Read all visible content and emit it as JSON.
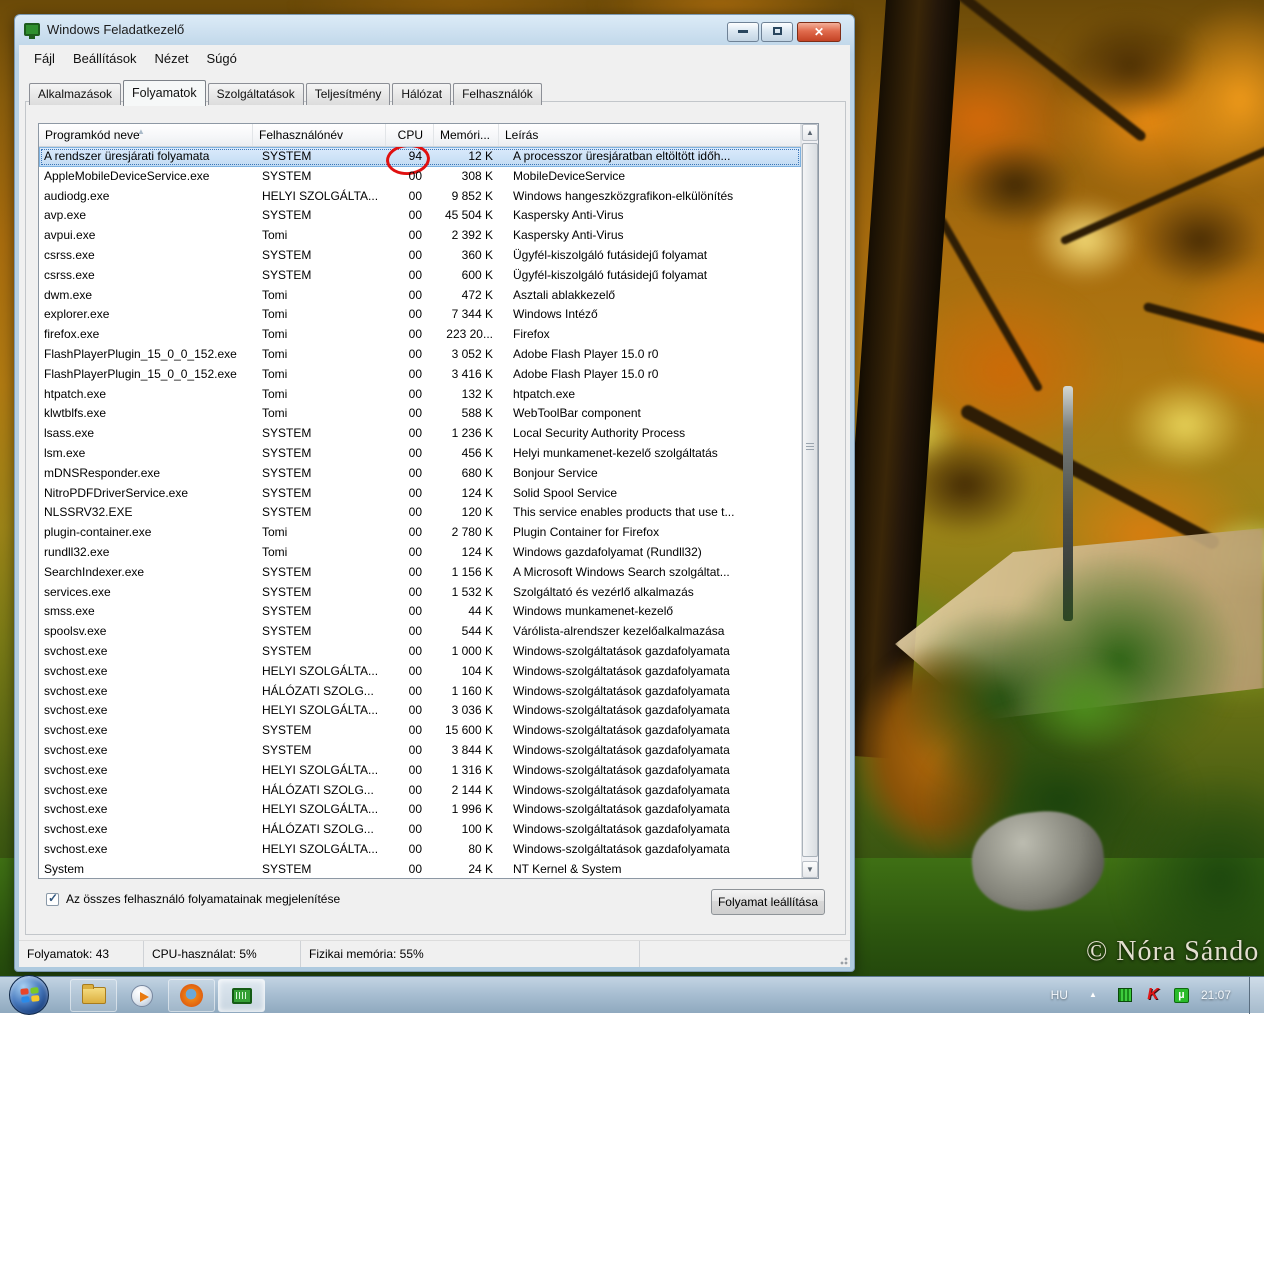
{
  "window": {
    "title": "Windows Feladatkezelő",
    "menu": [
      {
        "label": "Fájl"
      },
      {
        "label": "Beállítások"
      },
      {
        "label": "Nézet"
      },
      {
        "label": "Súgó"
      }
    ],
    "tabs": [
      {
        "label": "Alkalmazások",
        "active": false
      },
      {
        "label": "Folyamatok",
        "active": true
      },
      {
        "label": "Szolgáltatások",
        "active": false
      },
      {
        "label": "Teljesítmény",
        "active": false
      },
      {
        "label": "Hálózat",
        "active": false
      },
      {
        "label": "Felhasználók",
        "active": false
      }
    ],
    "columns": [
      "Programkód neve",
      "Felhasználónév",
      "CPU",
      "Memóri...",
      "Leírás"
    ],
    "sort_icon": "▲",
    "processes": [
      {
        "name": "A rendszer üresjárati folyamata",
        "user": "SYSTEM",
        "cpu": "94",
        "mem": "12 K",
        "desc": "A processzor üresjáratban eltöltött időh...",
        "selected": true,
        "circled": true
      },
      {
        "name": "AppleMobileDeviceService.exe",
        "user": "SYSTEM",
        "cpu": "00",
        "mem": "308 K",
        "desc": "MobileDeviceService"
      },
      {
        "name": "audiodg.exe",
        "user": "HELYI SZOLGÁLTA...",
        "cpu": "00",
        "mem": "9 852 K",
        "desc": "Windows hangeszközgrafikon-elkülönítés"
      },
      {
        "name": "avp.exe",
        "user": "SYSTEM",
        "cpu": "00",
        "mem": "45 504 K",
        "desc": "Kaspersky Anti-Virus"
      },
      {
        "name": "avpui.exe",
        "user": "Tomi",
        "cpu": "00",
        "mem": "2 392 K",
        "desc": "Kaspersky Anti-Virus"
      },
      {
        "name": "csrss.exe",
        "user": "SYSTEM",
        "cpu": "00",
        "mem": "360 K",
        "desc": "Ügyfél-kiszolgáló futásidejű folyamat"
      },
      {
        "name": "csrss.exe",
        "user": "SYSTEM",
        "cpu": "00",
        "mem": "600 K",
        "desc": "Ügyfél-kiszolgáló futásidejű folyamat"
      },
      {
        "name": "dwm.exe",
        "user": "Tomi",
        "cpu": "00",
        "mem": "472 K",
        "desc": "Asztali ablakkezelő"
      },
      {
        "name": "explorer.exe",
        "user": "Tomi",
        "cpu": "00",
        "mem": "7 344 K",
        "desc": "Windows Intéző"
      },
      {
        "name": "firefox.exe",
        "user": "Tomi",
        "cpu": "00",
        "mem": "223 20...",
        "desc": "Firefox"
      },
      {
        "name": "FlashPlayerPlugin_15_0_0_152.exe",
        "user": "Tomi",
        "cpu": "00",
        "mem": "3 052 K",
        "desc": "Adobe Flash Player 15.0 r0"
      },
      {
        "name": "FlashPlayerPlugin_15_0_0_152.exe",
        "user": "Tomi",
        "cpu": "00",
        "mem": "3 416 K",
        "desc": "Adobe Flash Player 15.0 r0"
      },
      {
        "name": "htpatch.exe",
        "user": "Tomi",
        "cpu": "00",
        "mem": "132 K",
        "desc": "htpatch.exe"
      },
      {
        "name": "klwtblfs.exe",
        "user": "Tomi",
        "cpu": "00",
        "mem": "588 K",
        "desc": "WebToolBar component"
      },
      {
        "name": "lsass.exe",
        "user": "SYSTEM",
        "cpu": "00",
        "mem": "1 236 K",
        "desc": "Local Security Authority Process"
      },
      {
        "name": "lsm.exe",
        "user": "SYSTEM",
        "cpu": "00",
        "mem": "456 K",
        "desc": "Helyi munkamenet-kezelő szolgáltatás"
      },
      {
        "name": "mDNSResponder.exe",
        "user": "SYSTEM",
        "cpu": "00",
        "mem": "680 K",
        "desc": "Bonjour Service"
      },
      {
        "name": "NitroPDFDriverService.exe",
        "user": "SYSTEM",
        "cpu": "00",
        "mem": "124 K",
        "desc": "Solid Spool Service"
      },
      {
        "name": "NLSSRV32.EXE",
        "user": "SYSTEM",
        "cpu": "00",
        "mem": "120 K",
        "desc": "This service enables products that use t..."
      },
      {
        "name": "plugin-container.exe",
        "user": "Tomi",
        "cpu": "00",
        "mem": "2 780 K",
        "desc": "Plugin Container for Firefox"
      },
      {
        "name": "rundll32.exe",
        "user": "Tomi",
        "cpu": "00",
        "mem": "124 K",
        "desc": "Windows gazdafolyamat (Rundll32)"
      },
      {
        "name": "SearchIndexer.exe",
        "user": "SYSTEM",
        "cpu": "00",
        "mem": "1 156 K",
        "desc": "A Microsoft Windows Search szolgáltat..."
      },
      {
        "name": "services.exe",
        "user": "SYSTEM",
        "cpu": "00",
        "mem": "1 532 K",
        "desc": "Szolgáltató és vezérlő alkalmazás"
      },
      {
        "name": "smss.exe",
        "user": "SYSTEM",
        "cpu": "00",
        "mem": "44 K",
        "desc": "Windows munkamenet-kezelő"
      },
      {
        "name": "spoolsv.exe",
        "user": "SYSTEM",
        "cpu": "00",
        "mem": "544 K",
        "desc": "Várólista-alrendszer kezelőalkalmazása"
      },
      {
        "name": "svchost.exe",
        "user": "SYSTEM",
        "cpu": "00",
        "mem": "1 000 K",
        "desc": "Windows-szolgáltatások gazdafolyamata"
      },
      {
        "name": "svchost.exe",
        "user": "HELYI SZOLGÁLTA...",
        "cpu": "00",
        "mem": "104 K",
        "desc": "Windows-szolgáltatások gazdafolyamata"
      },
      {
        "name": "svchost.exe",
        "user": "HÁLÓZATI SZOLG...",
        "cpu": "00",
        "mem": "1 160 K",
        "desc": "Windows-szolgáltatások gazdafolyamata"
      },
      {
        "name": "svchost.exe",
        "user": "HELYI SZOLGÁLTA...",
        "cpu": "00",
        "mem": "3 036 K",
        "desc": "Windows-szolgáltatások gazdafolyamata"
      },
      {
        "name": "svchost.exe",
        "user": "SYSTEM",
        "cpu": "00",
        "mem": "15 600 K",
        "desc": "Windows-szolgáltatások gazdafolyamata"
      },
      {
        "name": "svchost.exe",
        "user": "SYSTEM",
        "cpu": "00",
        "mem": "3 844 K",
        "desc": "Windows-szolgáltatások gazdafolyamata"
      },
      {
        "name": "svchost.exe",
        "user": "HELYI SZOLGÁLTA...",
        "cpu": "00",
        "mem": "1 316 K",
        "desc": "Windows-szolgáltatások gazdafolyamata"
      },
      {
        "name": "svchost.exe",
        "user": "HÁLÓZATI SZOLG...",
        "cpu": "00",
        "mem": "2 144 K",
        "desc": "Windows-szolgáltatások gazdafolyamata"
      },
      {
        "name": "svchost.exe",
        "user": "HELYI SZOLGÁLTA...",
        "cpu": "00",
        "mem": "1 996 K",
        "desc": "Windows-szolgáltatások gazdafolyamata"
      },
      {
        "name": "svchost.exe",
        "user": "HÁLÓZATI SZOLG...",
        "cpu": "00",
        "mem": "100 K",
        "desc": "Windows-szolgáltatások gazdafolyamata"
      },
      {
        "name": "svchost.exe",
        "user": "HELYI SZOLGÁLTA...",
        "cpu": "00",
        "mem": "80 K",
        "desc": "Windows-szolgáltatások gazdafolyamata"
      },
      {
        "name": "System",
        "user": "SYSTEM",
        "cpu": "00",
        "mem": "24 K",
        "desc": "NT Kernel & System"
      }
    ],
    "checkbox": {
      "label": "Az összes felhasználó folyamatainak megjelenítése",
      "checked": true
    },
    "end_process_button": "Folyamat leállítása",
    "status": {
      "processes": "Folyamatok: 43",
      "cpu": "CPU-használat: 5%",
      "memory": "Fizikai memória: 55%"
    },
    "caption_buttons": {
      "minimize": "minimize",
      "maximize": "maximize",
      "close": "✕"
    }
  },
  "taskbar": {
    "buttons": [
      {
        "icon": "folder-explorer-icon",
        "frameless": false,
        "active": false
      },
      {
        "icon": "media-player-icon",
        "frameless": true,
        "active": false
      },
      {
        "icon": "firefox-icon",
        "frameless": false,
        "active": false
      },
      {
        "icon": "task-manager-icon",
        "frameless": false,
        "active": true
      }
    ],
    "tray": {
      "language": "HU",
      "chevron_icon": "▲",
      "icons": [
        {
          "icon": "green-bars-icon",
          "glyph": ""
        },
        {
          "icon": "kaspersky-icon",
          "glyph": "K"
        },
        {
          "icon": "utorrent-icon",
          "glyph": "µ"
        }
      ],
      "time": "21:07"
    }
  },
  "desktop": {
    "watermark": "© Nóra Sándo"
  },
  "colors": {
    "selection_fill": "#cde4f7",
    "annotation_circle": "#e01010",
    "close_button": "#d9553d",
    "taskbar": "#a9bfd2",
    "window_frame": "#b9d2e6"
  }
}
